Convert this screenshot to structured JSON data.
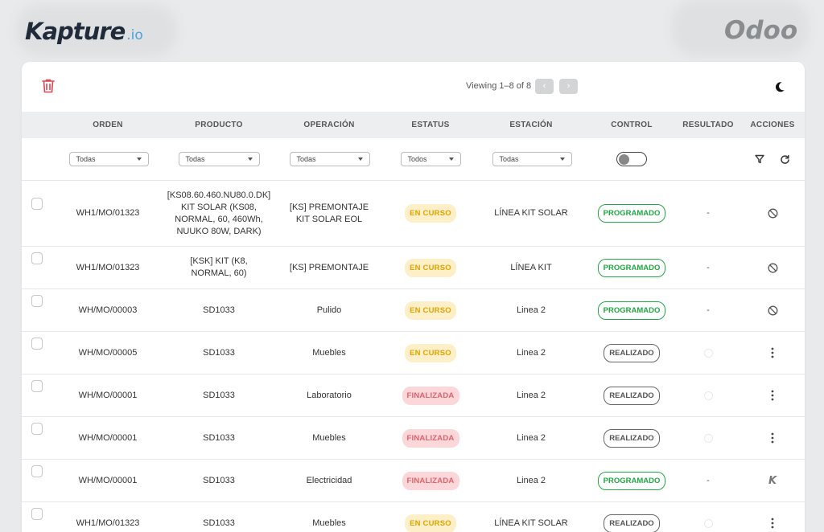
{
  "brand": {
    "left_main": "Kapture",
    "left_suffix": ".io",
    "right": "Odoo"
  },
  "toolbar": {
    "viewing": "Viewing 1–8 of 8",
    "prev": "‹",
    "next": "›"
  },
  "columns": [
    "ORDEN",
    "PRODUCTO",
    "OPERACIÓN",
    "ESTATUS",
    "ESTACIÓN",
    "CONTROL",
    "RESULTADO",
    "ACCIONES"
  ],
  "filters": {
    "orden": "Todas",
    "producto": "Todas",
    "operacion": "Todas",
    "estatus": "Todos",
    "estacion": "Todas"
  },
  "rows": [
    {
      "orden": "WH1/MO/01323",
      "producto": "[KS08.60.460.NU80.0.DK] KIT SOLAR (KS08, NORMAL, 60, 460Wh, NUUKO 80W, DARK)",
      "operacion": "[KS] PREMONTAJE KIT SOLAR EOL",
      "estatus": "EN CURSO",
      "estacion": "LÍNEA KIT SOLAR",
      "control": "PROGRAMADO",
      "resultado": "-",
      "accion": "ban-icon"
    },
    {
      "orden": "WH1/MO/01323",
      "producto": "[KSK] KIT (K8, NORMAL, 60)",
      "operacion": "[KS] PREMONTAJE",
      "estatus": "EN CURSO",
      "estacion": "LÍNEA KIT",
      "control": "PROGRAMADO",
      "resultado": "-",
      "accion": "ban-icon"
    },
    {
      "orden": "WH/MO/00003",
      "producto": "SD1033",
      "operacion": "Pulido",
      "estatus": "EN CURSO",
      "estacion": "Linea 2",
      "control": "PROGRAMADO",
      "resultado": "-",
      "accion": "ban-icon"
    },
    {
      "orden": "WH/MO/00005",
      "producto": "SD1033",
      "operacion": "Muebles",
      "estatus": "EN CURSO",
      "estacion": "Linea 2",
      "control": "REALIZADO",
      "resultado": "",
      "accion": "kebab-icon"
    },
    {
      "orden": "WH/MO/00001",
      "producto": "SD1033",
      "operacion": "Laboratorio",
      "estatus": "FINALIZADA",
      "estacion": "Linea 2",
      "control": "REALIZADO",
      "resultado": "",
      "accion": "kebab-icon"
    },
    {
      "orden": "WH/MO/00001",
      "producto": "SD1033",
      "operacion": "Muebles",
      "estatus": "FINALIZADA",
      "estacion": "Linea 2",
      "control": "REALIZADO",
      "resultado": "",
      "accion": "kebab-icon"
    },
    {
      "orden": "WH/MO/00001",
      "producto": "SD1033",
      "operacion": "Electricidad",
      "estatus": "FINALIZADA",
      "estacion": "Linea 2",
      "control": "PROGRAMADO",
      "resultado": "-",
      "accion": "kapture-k-icon"
    },
    {
      "orden": "WH1/MO/01323",
      "producto": "SD1033",
      "operacion": "Muebles",
      "estatus": "EN CURSO",
      "estacion": "LÍNEA KIT SOLAR",
      "control": "REALIZADO",
      "resultado": "",
      "accion": "kebab-icon"
    }
  ],
  "k_glyph": "K",
  "colors": {
    "en_curso": "#e0a300",
    "finalizada": "#e0626c",
    "programado": "#22a745",
    "delete": "#e0444f"
  }
}
